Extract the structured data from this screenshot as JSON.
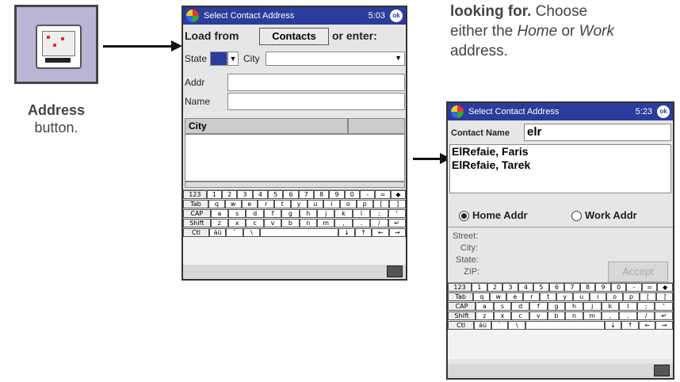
{
  "left": {
    "caption_bold": "Address",
    "caption_rest": "button."
  },
  "intro": {
    "line1_bold": "looking for.",
    "line1_rest": "Choose",
    "line2_prefix": "either the",
    "line2_home": "Home",
    "line2_or": "or",
    "line2_work": "Work",
    "line3": "address."
  },
  "screen1": {
    "title": "Select Contact Address",
    "clock": "5:03",
    "ok": "ok",
    "load_from": "Load from",
    "contacts_btn": "Contacts",
    "or_enter": "or enter:",
    "state_label": "State",
    "city_label": "City",
    "addr_label": "Addr",
    "name_label": "Name",
    "grid_header": "City"
  },
  "screen2": {
    "title": "Select Contact Address",
    "clock": "5:23",
    "ok": "ok",
    "contact_name_label": "Contact Name",
    "contact_name_value": "elr",
    "results": [
      "ElRefaie, Faris",
      "ElRefaie, Tarek"
    ],
    "home_addr": "Home Addr",
    "work_addr": "Work Addr",
    "street_label": "Street:",
    "city_label": "City:",
    "state_label": "State:",
    "zip_label": "ZIP:",
    "accept_btn": "Accept"
  },
  "keyboard": {
    "row1": [
      "123",
      "1",
      "2",
      "3",
      "4",
      "5",
      "6",
      "7",
      "8",
      "9",
      "0",
      "-",
      "=",
      "◆"
    ],
    "row2": [
      "Tab",
      "q",
      "w",
      "e",
      "r",
      "t",
      "y",
      "u",
      "i",
      "o",
      "p",
      "[",
      "]"
    ],
    "row3": [
      "CAP",
      "a",
      "s",
      "d",
      "f",
      "g",
      "h",
      "j",
      "k",
      "l",
      ";",
      "'"
    ],
    "row4": [
      "Shift",
      "z",
      "x",
      "c",
      "v",
      "b",
      "n",
      "m",
      ",",
      ".",
      "/",
      "↵"
    ],
    "row5": [
      "Ctl",
      "áü",
      "`",
      "\\",
      " ",
      "↓",
      "↑",
      "←",
      "→"
    ]
  }
}
